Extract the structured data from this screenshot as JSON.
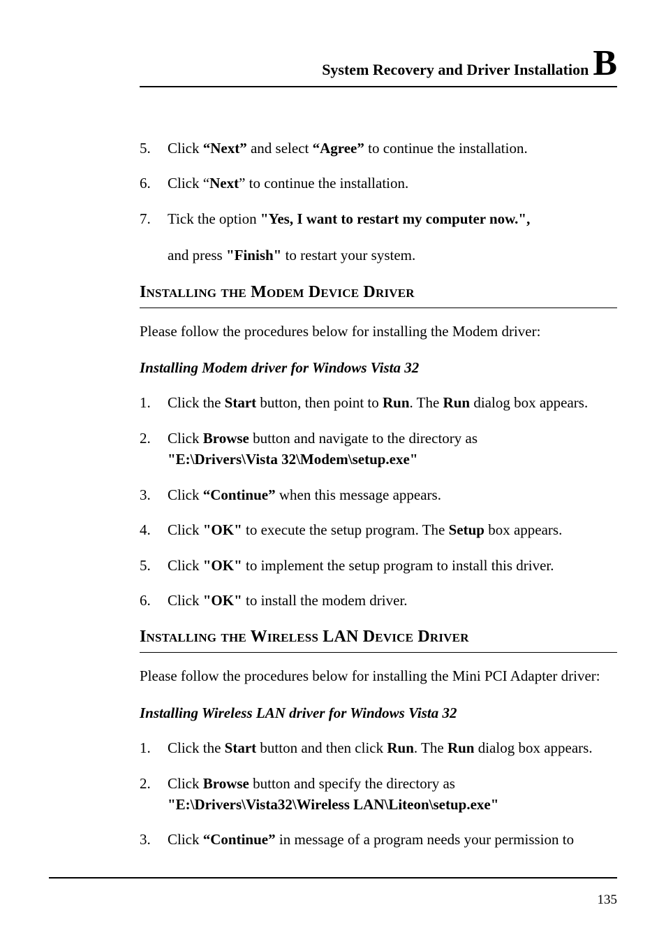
{
  "header": {
    "running_title": "System Recovery and Driver Installation",
    "appendix_letter": "B"
  },
  "section_top": {
    "items": [
      {
        "num": "5.",
        "pre": "Click ",
        "b1": "“Next”",
        "mid": " and select ",
        "b2": "“Agree”",
        "post": " to continue the installation."
      },
      {
        "num": "6.",
        "pre": "Click “",
        "b1": "Next",
        "post": "” to continue the installation."
      },
      {
        "num": "7.",
        "pre": "Tick the option ",
        "b1": "\"Yes, I want to restart my computer now.\",",
        "line2_pre": "and press ",
        "line2_b": "\"Finish\"",
        "line2_post": " to restart your system."
      }
    ]
  },
  "modem": {
    "heading": "Installing the Modem Device Driver",
    "intro": "Please follow the procedures below for installing the Modem driver:",
    "subhead": "Installing Modem driver for Windows Vista 32",
    "items": [
      {
        "num": "1.",
        "pre": "Click the ",
        "b1": "Start",
        "mid": " button, then point to ",
        "b2": "Run",
        "mid2": ". The ",
        "b3": "Run",
        "post": " dialog box appears."
      },
      {
        "num": "2.",
        "pre": "Click ",
        "b1": "Browse",
        "post_line1": " button and navigate to the directory as",
        "b_line2": "\"E:\\Drivers\\Vista 32\\Modem\\setup.exe\""
      },
      {
        "num": "3.",
        "pre": "Click ",
        "b1": "“Continue”",
        "post": " when this message appears."
      },
      {
        "num": "4.",
        "pre": "Click ",
        "b1": "\"OK\"",
        "mid": " to execute the setup program. The ",
        "b2": "Setup",
        "post": " box appears."
      },
      {
        "num": "5.",
        "pre": "Click ",
        "b1": "\"OK\"",
        "post": " to implement the setup program to install this driver."
      },
      {
        "num": "6.",
        "pre": "Click ",
        "b1": "\"OK\"",
        "post": " to install the modem driver."
      }
    ]
  },
  "wlan": {
    "heading": "Installing the Wireless LAN Device Driver",
    "intro": "Please follow the procedures below for installing the Mini PCI Adapter driver:",
    "subhead": "Installing Wireless LAN driver for Windows Vista 32",
    "items": [
      {
        "num": "1.",
        "pre": "Click the ",
        "b1": "Start",
        "mid": " button and then click ",
        "b2": "Run",
        "mid2": ". The ",
        "b3": "Run",
        "post": " dialog box appears."
      },
      {
        "num": "2.",
        "pre": "Click ",
        "b1": "Browse",
        "post_line1": " button and specify the directory as",
        "b_line2": "\"E:\\Drivers\\Vista32\\Wireless LAN\\Liteon\\setup.exe\""
      },
      {
        "num": "3.",
        "pre": "Click ",
        "b1": "“Continue”",
        "post": " in message of a program needs your permission to"
      }
    ]
  },
  "page_number": "135"
}
